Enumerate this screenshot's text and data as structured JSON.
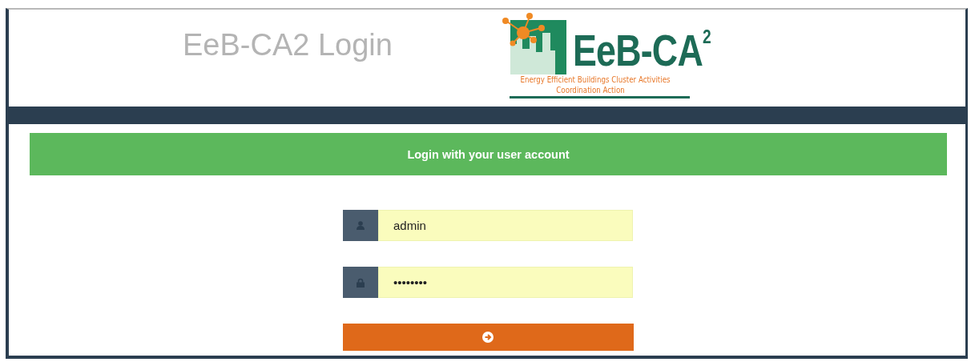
{
  "header": {
    "title": "EeB-CA2 Login",
    "logo": {
      "title": "EeB-CA$^{2}$",
      "subtitle_lines": [
        "Energy Efficient Buildings Cluster Activities",
        "Coordination Action"
      ]
    }
  },
  "banner": {
    "text": "Login with your user account"
  },
  "fields": [
    {
      "kind": "user",
      "value": "admin"
    },
    {
      "kind": "password",
      "value": "••••••••"
    }
  ]
}
